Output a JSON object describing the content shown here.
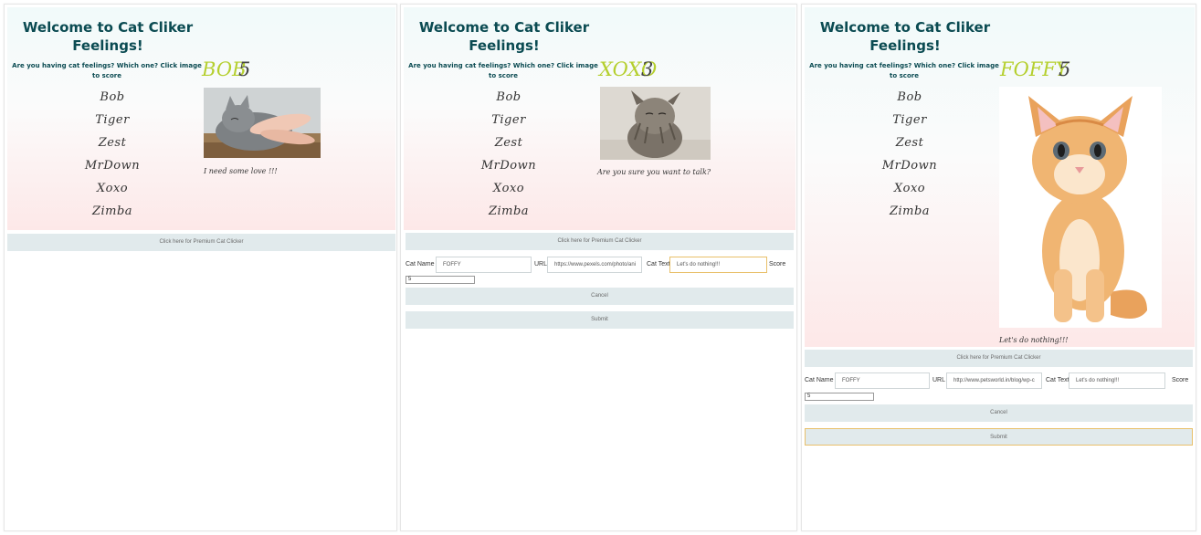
{
  "app": {
    "title": "Welcome to Cat Cliker Feelings!",
    "subtitle": "Are you having cat feelings? Which one? Click image to score"
  },
  "cats": [
    "Bob",
    "Tiger",
    "Zest",
    "MrDown",
    "Xoxo",
    "Zimba"
  ],
  "panels": [
    {
      "selected_name": "BOB",
      "selected_score": "5",
      "cat_text": "I need some love !!!",
      "image": "grey-cat-photo",
      "premium_label": "Click here for Premium Cat Clicker"
    },
    {
      "selected_name": "XOXO",
      "selected_score": "3",
      "cat_text": "Are you sure you want to talk?",
      "image": "fluffy-grey-cat-photo",
      "premium_label": "Click here for Premium Cat Clicker",
      "admin": {
        "labels": {
          "name": "Cat Name",
          "url": "URL",
          "text": "Cat Text",
          "score": "Score"
        },
        "name_value": "FOFFY",
        "url_value": "https://www.pexels.com/photo/ani",
        "text_value": "Let's do nothing!!!",
        "score_value": "5",
        "cancel_label": "Cancel",
        "submit_label": "Submit"
      }
    },
    {
      "selected_name": "FOFFY",
      "selected_score": "5",
      "cat_text": "Let's do nothing!!!",
      "image": "orange-kitten-photo",
      "premium_label": "Click here for Premium Cat Clicker",
      "admin": {
        "labels": {
          "name": "Cat Name",
          "url": "URL",
          "text": "Cat Text",
          "score": "Score"
        },
        "name_value": "FOFFY",
        "url_value": "http://www.petsworld.in/blog/wp-c",
        "text_value": "Let's do nothing!!!",
        "score_value": "5",
        "cancel_label": "Cancel",
        "submit_label": "Submit"
      }
    }
  ],
  "colors": {
    "title": "#0b4b52",
    "selected_name": "#b5cf2e",
    "button_bg": "#e1eaec",
    "focus_border": "#e8c06a"
  }
}
